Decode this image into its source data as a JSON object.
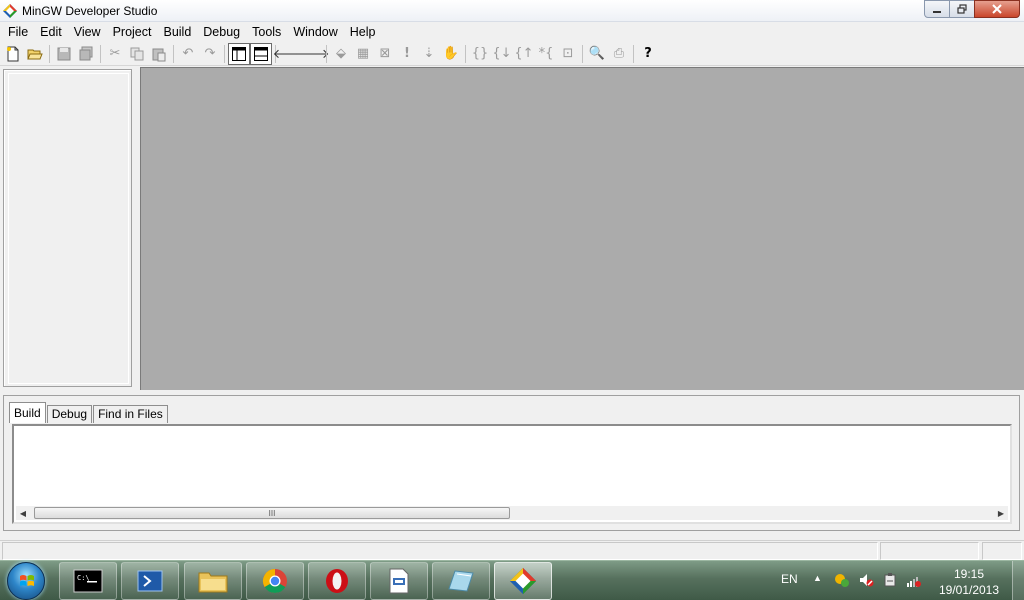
{
  "window": {
    "title": "MinGW Developer Studio"
  },
  "menu": [
    "File",
    "Edit",
    "View",
    "Project",
    "Build",
    "Debug",
    "Tools",
    "Window",
    "Help"
  ],
  "output": {
    "tabs": [
      "Build",
      "Debug",
      "Find in Files"
    ],
    "active_tab": "Build",
    "scroll_grip": "III"
  },
  "taskbar": {
    "language": "EN",
    "clock_time": "19:15",
    "clock_date": "19/01/2013",
    "tray_arrow": "▲"
  },
  "colors": {
    "mdi_background": "#ababab",
    "taskbar": "#56705d",
    "close_button": "#c9462b"
  }
}
